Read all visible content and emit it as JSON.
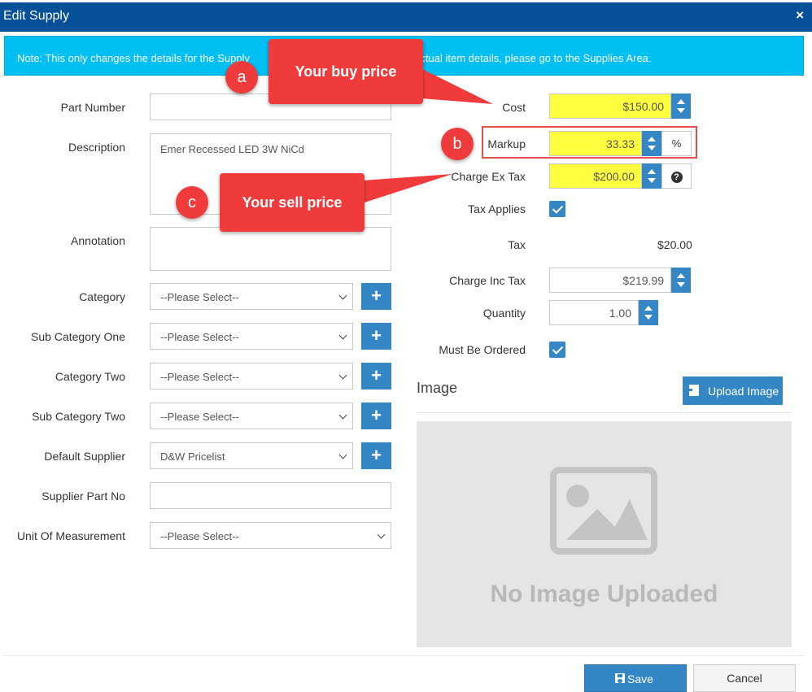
{
  "dialog": {
    "title": "Edit Supply",
    "close_glyph": "×"
  },
  "note": {
    "text": "Note: This only changes the details for the Supply                                               o the actual item details, please go to the Supplies Area."
  },
  "left": {
    "part_number_label": "Part Number",
    "part_number_value": "",
    "description_label": "Description",
    "description_value": "Emer Recessed LED 3W NiCd",
    "annotation_label": "Annotation",
    "annotation_value": "",
    "category_label": "Category",
    "category_value": "--Please Select--",
    "sub_category_one_label": "Sub Category One",
    "sub_category_one_value": "--Please Select--",
    "category_two_label": "Category Two",
    "category_two_value": "--Please Select--",
    "sub_category_two_label": "Sub Category Two",
    "sub_category_two_value": "--Please Select--",
    "default_supplier_label": "Default Supplier",
    "default_supplier_value": "D&W Pricelist",
    "supplier_part_no_label": "Supplier Part No",
    "supplier_part_no_value": "",
    "unit_label": "Unit Of Measurement",
    "unit_value": "--Please Select--",
    "plus_glyph": "+"
  },
  "right": {
    "cost_label": "Cost",
    "cost_value": "$150.00",
    "markup_label": "Markup",
    "markup_value": "33.33",
    "markup_unit": "%",
    "charge_ex_label": "Charge Ex Tax",
    "charge_ex_value": "$200.00",
    "help_glyph": "?",
    "tax_applies_label": "Tax Applies",
    "tax_applies_checked": true,
    "tax_label": "Tax",
    "tax_value": "$20.00",
    "charge_inc_label": "Charge Inc Tax",
    "charge_inc_value": "$219.99",
    "quantity_label": "Quantity",
    "quantity_value": "1.00",
    "must_be_ordered_label": "Must Be Ordered",
    "must_be_ordered_checked": true
  },
  "image": {
    "section_title": "Image",
    "upload_label": "Upload Image",
    "placeholder_text": "No Image Uploaded"
  },
  "footer": {
    "save_label": "Save",
    "cancel_label": "Cancel"
  },
  "annotations": {
    "a": {
      "letter": "a",
      "text": "Your buy price"
    },
    "b": {
      "letter": "b"
    },
    "c": {
      "letter": "c",
      "text": "Your sell price"
    }
  },
  "colors": {
    "header": "#055096",
    "note_bg": "#00bff3",
    "accent": "#3486c5",
    "highlight": "#ffff40",
    "callout": "#ef3b3b"
  },
  "icons": {
    "close": "close-icon",
    "plus": "plus-icon",
    "spinner": "spinner-icon",
    "help": "question-circle-icon",
    "check": "check-icon",
    "upload": "upload-icon",
    "save": "floppy-disk-icon",
    "placeholder": "image-placeholder-icon"
  }
}
